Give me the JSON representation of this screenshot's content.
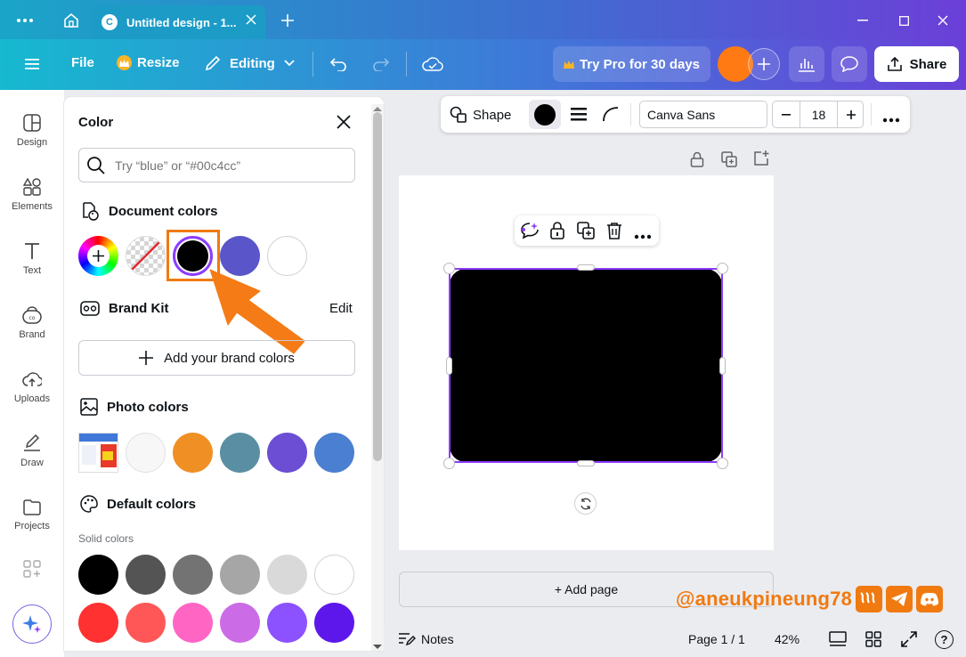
{
  "titlebar": {
    "tab_title": "Untitled design - 1...",
    "tab_logo": "C"
  },
  "toolbar": {
    "file": "File",
    "resize": "Resize",
    "editing": "Editing",
    "try_pro": "Try Pro for 30 days",
    "share": "Share"
  },
  "rail": {
    "items": [
      {
        "label": "Design",
        "icon": "design-icon"
      },
      {
        "label": "Elements",
        "icon": "elements-icon"
      },
      {
        "label": "Text",
        "icon": "text-icon"
      },
      {
        "label": "Brand",
        "icon": "brand-icon"
      },
      {
        "label": "Uploads",
        "icon": "uploads-icon"
      },
      {
        "label": "Draw",
        "icon": "draw-icon"
      },
      {
        "label": "Projects",
        "icon": "projects-icon"
      }
    ]
  },
  "panel": {
    "title": "Color",
    "search_placeholder": "Try “blue” or “#00c4cc”",
    "document_colors": {
      "label": "Document colors",
      "swatches": [
        "#000000",
        "#5a55c9",
        "#ffffff"
      ]
    },
    "brand_kit": {
      "label": "Brand Kit",
      "edit": "Edit",
      "add_button": "Add your brand colors"
    },
    "photo_colors": {
      "label": "Photo colors",
      "swatches": [
        "#f7f7f7",
        "#ef8f24",
        "#5a8fa3",
        "#6c4ed4",
        "#4a7fd1"
      ]
    },
    "default_colors": {
      "label": "Default colors",
      "solid_label": "Solid colors",
      "row1": [
        "#000000",
        "#545454",
        "#737373",
        "#a6a6a6",
        "#d9d9d9",
        "#ffffff"
      ],
      "row2": [
        "#ff3131",
        "#ff5757",
        "#ff66c4",
        "#cb6ce6",
        "#8c52ff",
        "#5e17eb"
      ]
    }
  },
  "context_bar": {
    "shape": "Shape",
    "font": "Canva Sans",
    "font_size": "18",
    "fill_color": "#000000"
  },
  "canvas": {
    "shape_color": "#000000",
    "selection_color": "#8b3dff",
    "add_page": "+ Add page"
  },
  "bottom": {
    "notes": "Notes",
    "page": "Page 1 / 1",
    "zoom": "42%"
  },
  "watermark": {
    "text": "@aneukpineung78"
  },
  "colors": {
    "accent": "#f07a10",
    "brand_purple": "#8b3dff"
  }
}
